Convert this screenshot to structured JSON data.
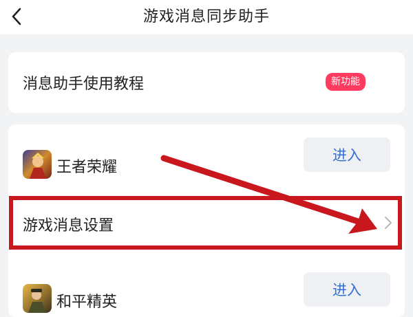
{
  "header": {
    "title": "游戏消息同步助手"
  },
  "tutorial": {
    "label": "消息助手使用教程",
    "badge": "新功能",
    "badge_color": "#ff3c60"
  },
  "games": [
    {
      "name": "王者荣耀",
      "enter_label": "进入",
      "icon": "honor-of-kings-app-icon"
    },
    {
      "name": "和平精英",
      "enter_label": "进入",
      "icon": "peacekeeper-elite-app-icon"
    }
  ],
  "settings_row": {
    "label": "游戏消息设置"
  },
  "colors": {
    "accent_link": "#2f6fd6",
    "annotation_red": "#c8171d",
    "page_background": "#f2f3f5"
  }
}
